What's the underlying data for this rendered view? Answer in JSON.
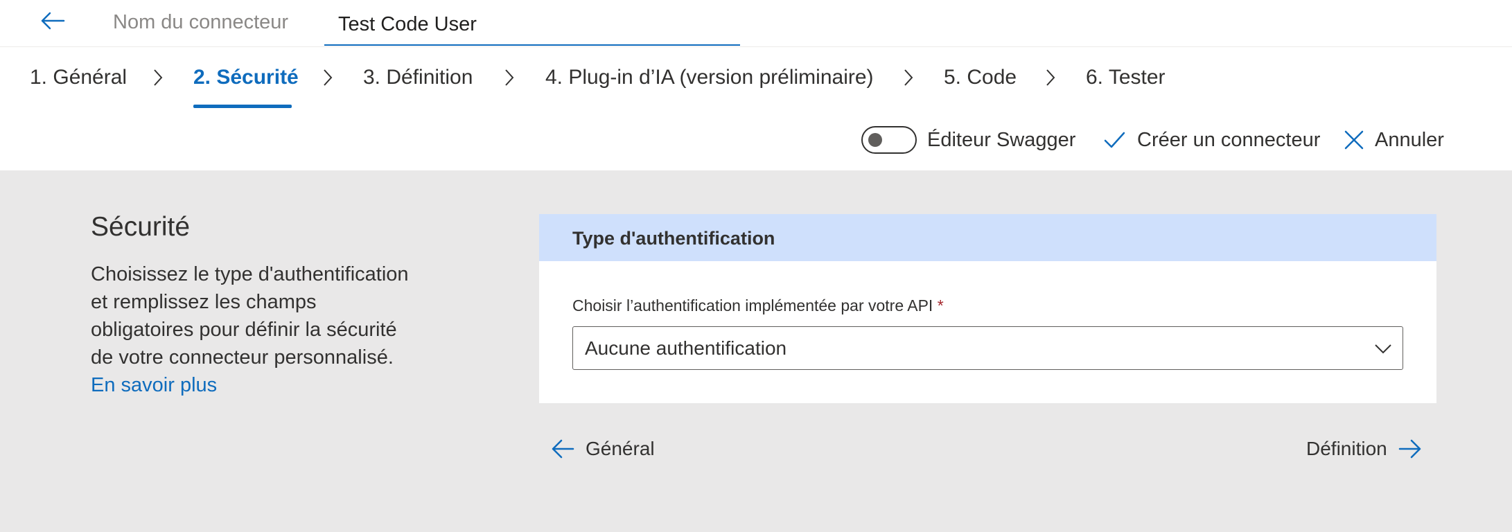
{
  "header": {
    "back_label": "Retour",
    "name_label": "Nom du connecteur",
    "name_value": "Test Code User"
  },
  "steps": [
    {
      "label": "1. Général"
    },
    {
      "label": "2. Sécurité"
    },
    {
      "label": "3. Définition"
    },
    {
      "label": "4. Plug-in d’IA (version préliminaire)"
    },
    {
      "label": "5. Code"
    },
    {
      "label": "6. Tester"
    }
  ],
  "active_step": "2. Sécurité",
  "toolbar": {
    "swagger_label": "Éditeur Swagger",
    "swagger_on": false,
    "create_label": "Créer un connecteur",
    "cancel_label": "Annuler"
  },
  "section": {
    "title": "Sécurité",
    "description": "Choisissez le type d'authentification et remplissez les champs obligatoires pour définir la sécurité de votre connecteur personnalisé.",
    "learn_more": "En savoir plus"
  },
  "card": {
    "header": "Type d'authentification",
    "field_label": "Choisir l’authentification implémentée par votre API",
    "required_mark": "*",
    "selected_value": "Aucune authentification"
  },
  "nav": {
    "prev_label": "Général",
    "next_label": "Définition"
  },
  "colors": {
    "accent": "#0f6cbd",
    "card_header": "#cfe0fc",
    "content_bg": "#e9e8e8"
  }
}
